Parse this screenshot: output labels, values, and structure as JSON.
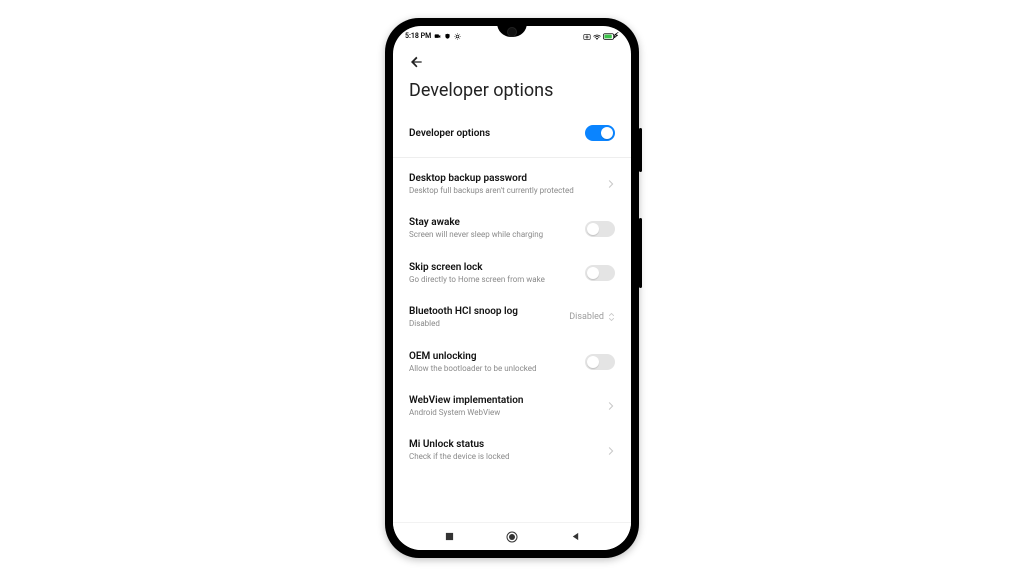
{
  "statusbar": {
    "time": "5:18 PM"
  },
  "header": {
    "title": "Developer options"
  },
  "master_toggle": {
    "label": "Developer options",
    "on": true
  },
  "items": [
    {
      "label": "Desktop backup password",
      "sub": "Desktop full backups aren't currently protected",
      "right": "chevron"
    },
    {
      "label": "Stay awake",
      "sub": "Screen will never sleep while charging",
      "right": "toggle",
      "on": false
    },
    {
      "label": "Skip screen lock",
      "sub": "Go directly to Home screen from wake",
      "right": "toggle",
      "on": false
    },
    {
      "label": "Bluetooth HCI snoop log",
      "sub": "Disabled",
      "right": "select",
      "value": "Disabled"
    },
    {
      "label": "OEM unlocking",
      "sub": "Allow the bootloader to be unlocked",
      "right": "toggle",
      "on": false
    },
    {
      "label": "WebView implementation",
      "sub": "Android System WebView",
      "right": "chevron"
    },
    {
      "label": "Mi Unlock status",
      "sub": "Check if the device is locked",
      "right": "chevron"
    }
  ]
}
